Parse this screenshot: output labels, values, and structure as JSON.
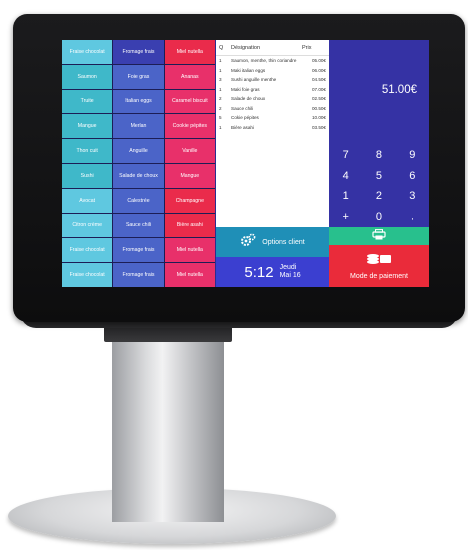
{
  "tiles": [
    [
      "Fraise chocolat",
      "Fromage frais",
      "Miel nutella"
    ],
    [
      "Saumon",
      "Foie gras",
      "Ananas"
    ],
    [
      "Truite",
      "Italian eggs",
      "Caramel biscuit"
    ],
    [
      "Mangue",
      "Merlan",
      "Cookie pépites"
    ],
    [
      "Thon cuit",
      "Anguille",
      "Vanille"
    ],
    [
      "Sushi",
      "Salade de choux",
      "Mangue"
    ],
    [
      "Avocat",
      "Calestrée",
      "Champagne"
    ],
    [
      "Citron crème",
      "Sauce chili",
      "Bière asahi"
    ],
    [
      "Fraise chocolat",
      "Fromage frais",
      "Miel nutella"
    ],
    [
      "Fraise chocolat",
      "Fromage frais",
      "Miel nutella"
    ]
  ],
  "receipt": {
    "headers": {
      "qty": "Q",
      "designation": "Désignation",
      "price": "Prix"
    },
    "lines": [
      {
        "qty": "1",
        "designation": "Saumon, menthe, thin coriandre",
        "price": "05.00€"
      },
      {
        "qty": "1",
        "designation": "Maki italian eggs",
        "price": "06.00€"
      },
      {
        "qty": "3",
        "designation": "Sushi anguille menthe",
        "price": "04.50€"
      },
      {
        "qty": "1",
        "designation": "Maki foie gras",
        "price": "07.00€"
      },
      {
        "qty": "2",
        "designation": "Salade de choux",
        "price": "02.50€"
      },
      {
        "qty": "2",
        "designation": "Sauce chili",
        "price": "00.50€"
      },
      {
        "qty": "5",
        "designation": "Cokie pépites",
        "price": "10.00€"
      },
      {
        "qty": "1",
        "designation": "Bière asahi",
        "price": "03.50€"
      }
    ]
  },
  "total": "51.00€",
  "keypad": [
    "7",
    "8",
    "9",
    "4",
    "5",
    "6",
    "1",
    "2",
    "3",
    "+",
    "0",
    ","
  ],
  "options_label": "Options client",
  "clock": {
    "time": "5:12",
    "day": "Jeudi",
    "date": "Mai 16"
  },
  "payment_label": "Mode de paiement"
}
